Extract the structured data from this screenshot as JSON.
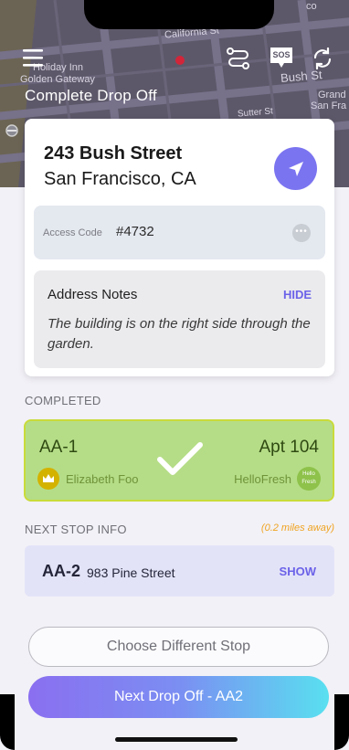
{
  "header": {
    "title": "Complete Drop Off",
    "sos_label": "SOS",
    "map_labels": {
      "california": "California St",
      "bush_st": "Bush St",
      "sutter_st": "Sutter St",
      "grand": "Grand",
      "san_fra": "San Fra",
      "holiday_inn": "Holiday Inn",
      "golden_gateway": "Golden Gateway",
      "co": "co"
    }
  },
  "address": {
    "line1": "243 Bush Street",
    "line2": "San Francisco, CA"
  },
  "access": {
    "label": "Access Code",
    "code": "#4732",
    "more": "•••"
  },
  "notes": {
    "title": "Address Notes",
    "hide_label": "HIDE",
    "text": "The building is on the right side through the garden."
  },
  "completed": {
    "section_label": "COMPLETED",
    "id": "AA-1",
    "apt": "Apt 104",
    "customer": "Elizabeth Foo",
    "brand": "HelloFresh",
    "brand_logo_text": "Hello Fresh"
  },
  "next_stop": {
    "section_label": "NEXT STOP INFO",
    "distance": "(0.2 miles away)",
    "id": "AA-2",
    "address": "983 Pine Street",
    "show_label": "SHOW"
  },
  "actions": {
    "choose_label": "Choose Different Stop",
    "primary_label": "Next Drop Off - AA2"
  },
  "colors": {
    "accent": "#7b74f0",
    "completed_bg": "#b5dd87",
    "distance": "#f0a320",
    "gradient_start": "#8a6ff0",
    "gradient_end": "#59e0f0"
  }
}
